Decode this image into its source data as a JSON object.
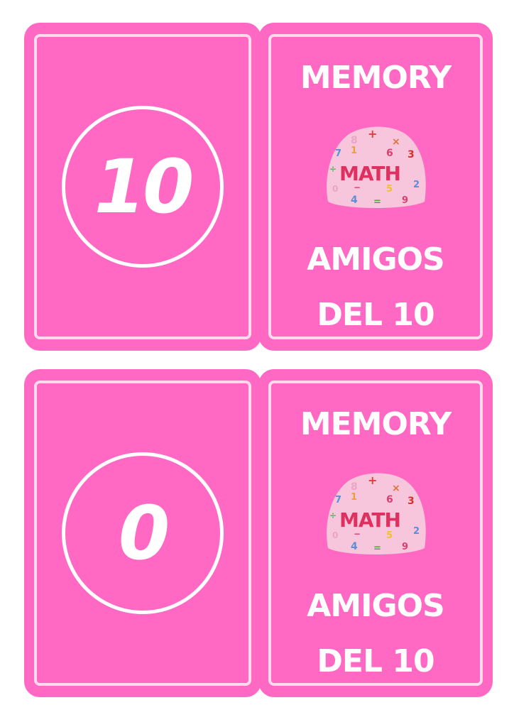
{
  "colors": {
    "card_bg": "#ff69c3",
    "inner_border": "#ffd9ec",
    "text": "#ffffff",
    "badge_bg": "#f7c6dc"
  },
  "cards": [
    {
      "type": "front",
      "number": "10"
    },
    {
      "type": "back",
      "title": "MEMORY",
      "badge_text": "MATH",
      "subtitle_line1": "AMIGOS",
      "subtitle_line2": "DEL 10"
    },
    {
      "type": "front",
      "number": "0"
    },
    {
      "type": "back",
      "title": "MEMORY",
      "badge_text": "MATH",
      "subtitle_line1": "AMIGOS",
      "subtitle_line2": "DEL 10"
    }
  ]
}
